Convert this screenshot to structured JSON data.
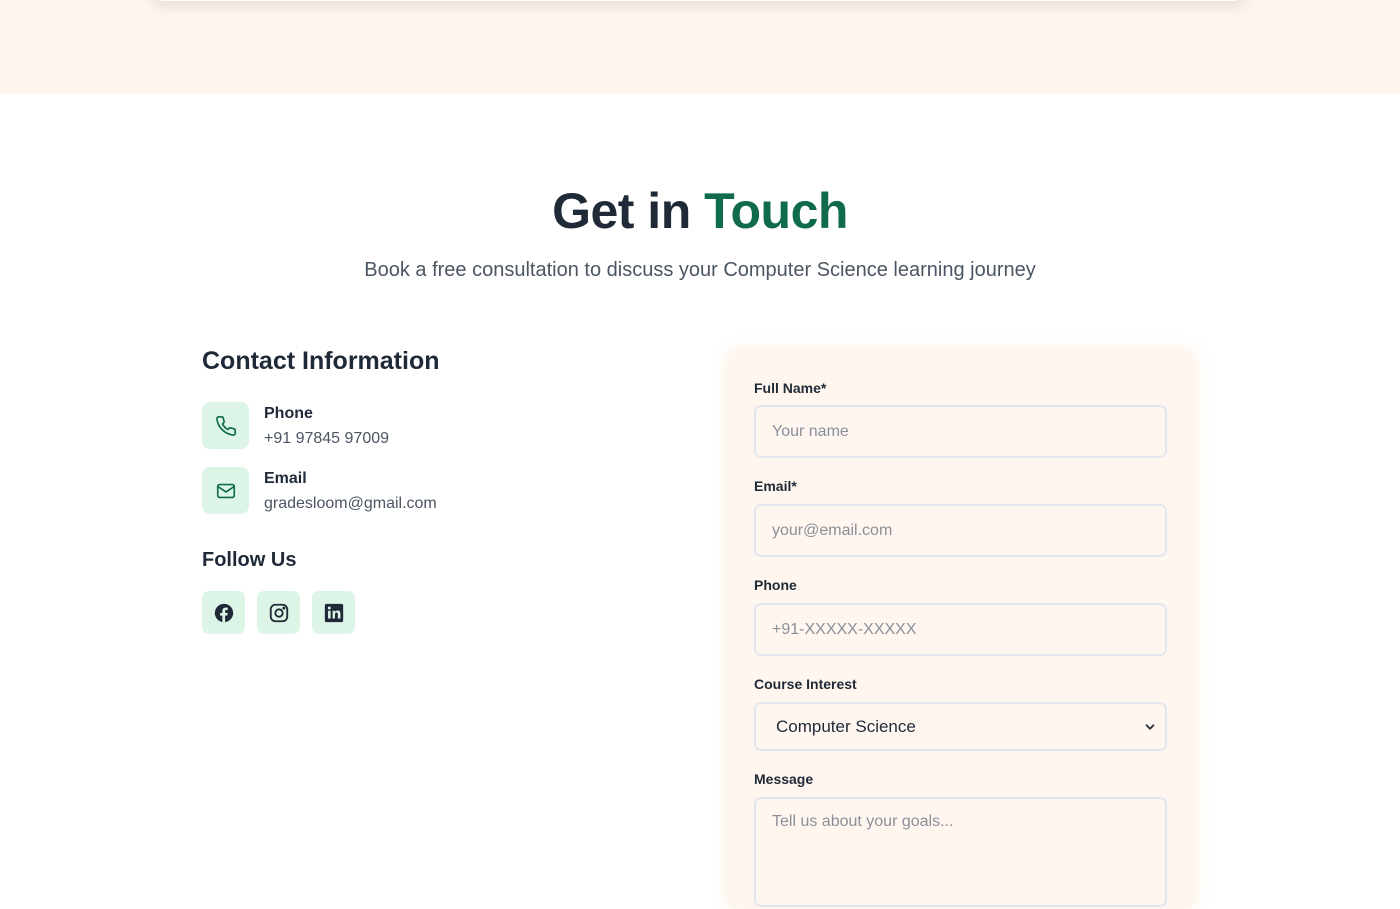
{
  "heading": {
    "part1": "Get in",
    "accent": "Touch"
  },
  "subheading": "Book a free consultation to discuss your Computer Science learning journey",
  "contact": {
    "title": "Contact Information",
    "phone": {
      "label": "Phone",
      "value": "+91 97845 97009",
      "icon": "phone-icon"
    },
    "email": {
      "label": "Email",
      "value": "gradesloom@gmail.com",
      "icon": "mail-icon"
    }
  },
  "follow": {
    "title": "Follow Us",
    "links": [
      "facebook-icon",
      "instagram-icon",
      "linkedin-icon"
    ]
  },
  "form": {
    "full_name": {
      "label": "Full Name*",
      "placeholder": "Your name"
    },
    "email": {
      "label": "Email*",
      "placeholder": "your@email.com"
    },
    "phone": {
      "label": "Phone",
      "placeholder": "+91-XXXXX-XXXXX"
    },
    "course": {
      "label": "Course Interest",
      "value": "Computer Science"
    },
    "message": {
      "label": "Message",
      "placeholder": "Tell us about your goals..."
    }
  },
  "colors": {
    "accent": "#0f6b4a",
    "icon_bg": "#dcf5e7",
    "band_bg": "#fff7ef",
    "text": "#1f2937"
  }
}
